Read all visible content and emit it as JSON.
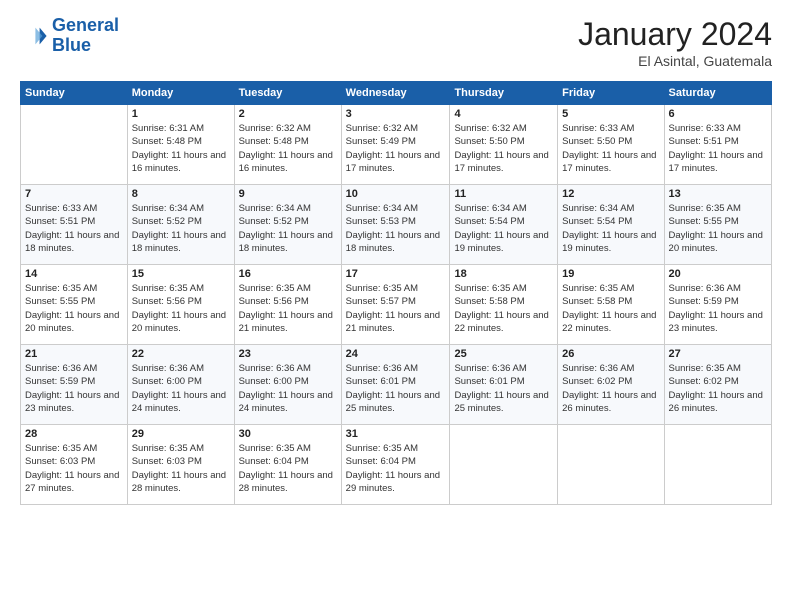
{
  "header": {
    "logo_line1": "General",
    "logo_line2": "Blue",
    "month_title": "January 2024",
    "location": "El Asintal, Guatemala"
  },
  "weekdays": [
    "Sunday",
    "Monday",
    "Tuesday",
    "Wednesday",
    "Thursday",
    "Friday",
    "Saturday"
  ],
  "weeks": [
    [
      {
        "day": "",
        "sunrise": "",
        "sunset": "",
        "daylight": ""
      },
      {
        "day": "1",
        "sunrise": "6:31 AM",
        "sunset": "5:48 PM",
        "daylight": "11 hours and 16 minutes."
      },
      {
        "day": "2",
        "sunrise": "6:32 AM",
        "sunset": "5:48 PM",
        "daylight": "11 hours and 16 minutes."
      },
      {
        "day": "3",
        "sunrise": "6:32 AM",
        "sunset": "5:49 PM",
        "daylight": "11 hours and 17 minutes."
      },
      {
        "day": "4",
        "sunrise": "6:32 AM",
        "sunset": "5:50 PM",
        "daylight": "11 hours and 17 minutes."
      },
      {
        "day": "5",
        "sunrise": "6:33 AM",
        "sunset": "5:50 PM",
        "daylight": "11 hours and 17 minutes."
      },
      {
        "day": "6",
        "sunrise": "6:33 AM",
        "sunset": "5:51 PM",
        "daylight": "11 hours and 17 minutes."
      }
    ],
    [
      {
        "day": "7",
        "sunrise": "6:33 AM",
        "sunset": "5:51 PM",
        "daylight": "11 hours and 18 minutes."
      },
      {
        "day": "8",
        "sunrise": "6:34 AM",
        "sunset": "5:52 PM",
        "daylight": "11 hours and 18 minutes."
      },
      {
        "day": "9",
        "sunrise": "6:34 AM",
        "sunset": "5:52 PM",
        "daylight": "11 hours and 18 minutes."
      },
      {
        "day": "10",
        "sunrise": "6:34 AM",
        "sunset": "5:53 PM",
        "daylight": "11 hours and 18 minutes."
      },
      {
        "day": "11",
        "sunrise": "6:34 AM",
        "sunset": "5:54 PM",
        "daylight": "11 hours and 19 minutes."
      },
      {
        "day": "12",
        "sunrise": "6:34 AM",
        "sunset": "5:54 PM",
        "daylight": "11 hours and 19 minutes."
      },
      {
        "day": "13",
        "sunrise": "6:35 AM",
        "sunset": "5:55 PM",
        "daylight": "11 hours and 20 minutes."
      }
    ],
    [
      {
        "day": "14",
        "sunrise": "6:35 AM",
        "sunset": "5:55 PM",
        "daylight": "11 hours and 20 minutes."
      },
      {
        "day": "15",
        "sunrise": "6:35 AM",
        "sunset": "5:56 PM",
        "daylight": "11 hours and 20 minutes."
      },
      {
        "day": "16",
        "sunrise": "6:35 AM",
        "sunset": "5:56 PM",
        "daylight": "11 hours and 21 minutes."
      },
      {
        "day": "17",
        "sunrise": "6:35 AM",
        "sunset": "5:57 PM",
        "daylight": "11 hours and 21 minutes."
      },
      {
        "day": "18",
        "sunrise": "6:35 AM",
        "sunset": "5:58 PM",
        "daylight": "11 hours and 22 minutes."
      },
      {
        "day": "19",
        "sunrise": "6:35 AM",
        "sunset": "5:58 PM",
        "daylight": "11 hours and 22 minutes."
      },
      {
        "day": "20",
        "sunrise": "6:36 AM",
        "sunset": "5:59 PM",
        "daylight": "11 hours and 23 minutes."
      }
    ],
    [
      {
        "day": "21",
        "sunrise": "6:36 AM",
        "sunset": "5:59 PM",
        "daylight": "11 hours and 23 minutes."
      },
      {
        "day": "22",
        "sunrise": "6:36 AM",
        "sunset": "6:00 PM",
        "daylight": "11 hours and 24 minutes."
      },
      {
        "day": "23",
        "sunrise": "6:36 AM",
        "sunset": "6:00 PM",
        "daylight": "11 hours and 24 minutes."
      },
      {
        "day": "24",
        "sunrise": "6:36 AM",
        "sunset": "6:01 PM",
        "daylight": "11 hours and 25 minutes."
      },
      {
        "day": "25",
        "sunrise": "6:36 AM",
        "sunset": "6:01 PM",
        "daylight": "11 hours and 25 minutes."
      },
      {
        "day": "26",
        "sunrise": "6:36 AM",
        "sunset": "6:02 PM",
        "daylight": "11 hours and 26 minutes."
      },
      {
        "day": "27",
        "sunrise": "6:35 AM",
        "sunset": "6:02 PM",
        "daylight": "11 hours and 26 minutes."
      }
    ],
    [
      {
        "day": "28",
        "sunrise": "6:35 AM",
        "sunset": "6:03 PM",
        "daylight": "11 hours and 27 minutes."
      },
      {
        "day": "29",
        "sunrise": "6:35 AM",
        "sunset": "6:03 PM",
        "daylight": "11 hours and 28 minutes."
      },
      {
        "day": "30",
        "sunrise": "6:35 AM",
        "sunset": "6:04 PM",
        "daylight": "11 hours and 28 minutes."
      },
      {
        "day": "31",
        "sunrise": "6:35 AM",
        "sunset": "6:04 PM",
        "daylight": "11 hours and 29 minutes."
      },
      {
        "day": "",
        "sunrise": "",
        "sunset": "",
        "daylight": ""
      },
      {
        "day": "",
        "sunrise": "",
        "sunset": "",
        "daylight": ""
      },
      {
        "day": "",
        "sunrise": "",
        "sunset": "",
        "daylight": ""
      }
    ]
  ],
  "labels": {
    "sunrise_prefix": "Sunrise: ",
    "sunset_prefix": "Sunset: ",
    "daylight_prefix": "Daylight: "
  }
}
